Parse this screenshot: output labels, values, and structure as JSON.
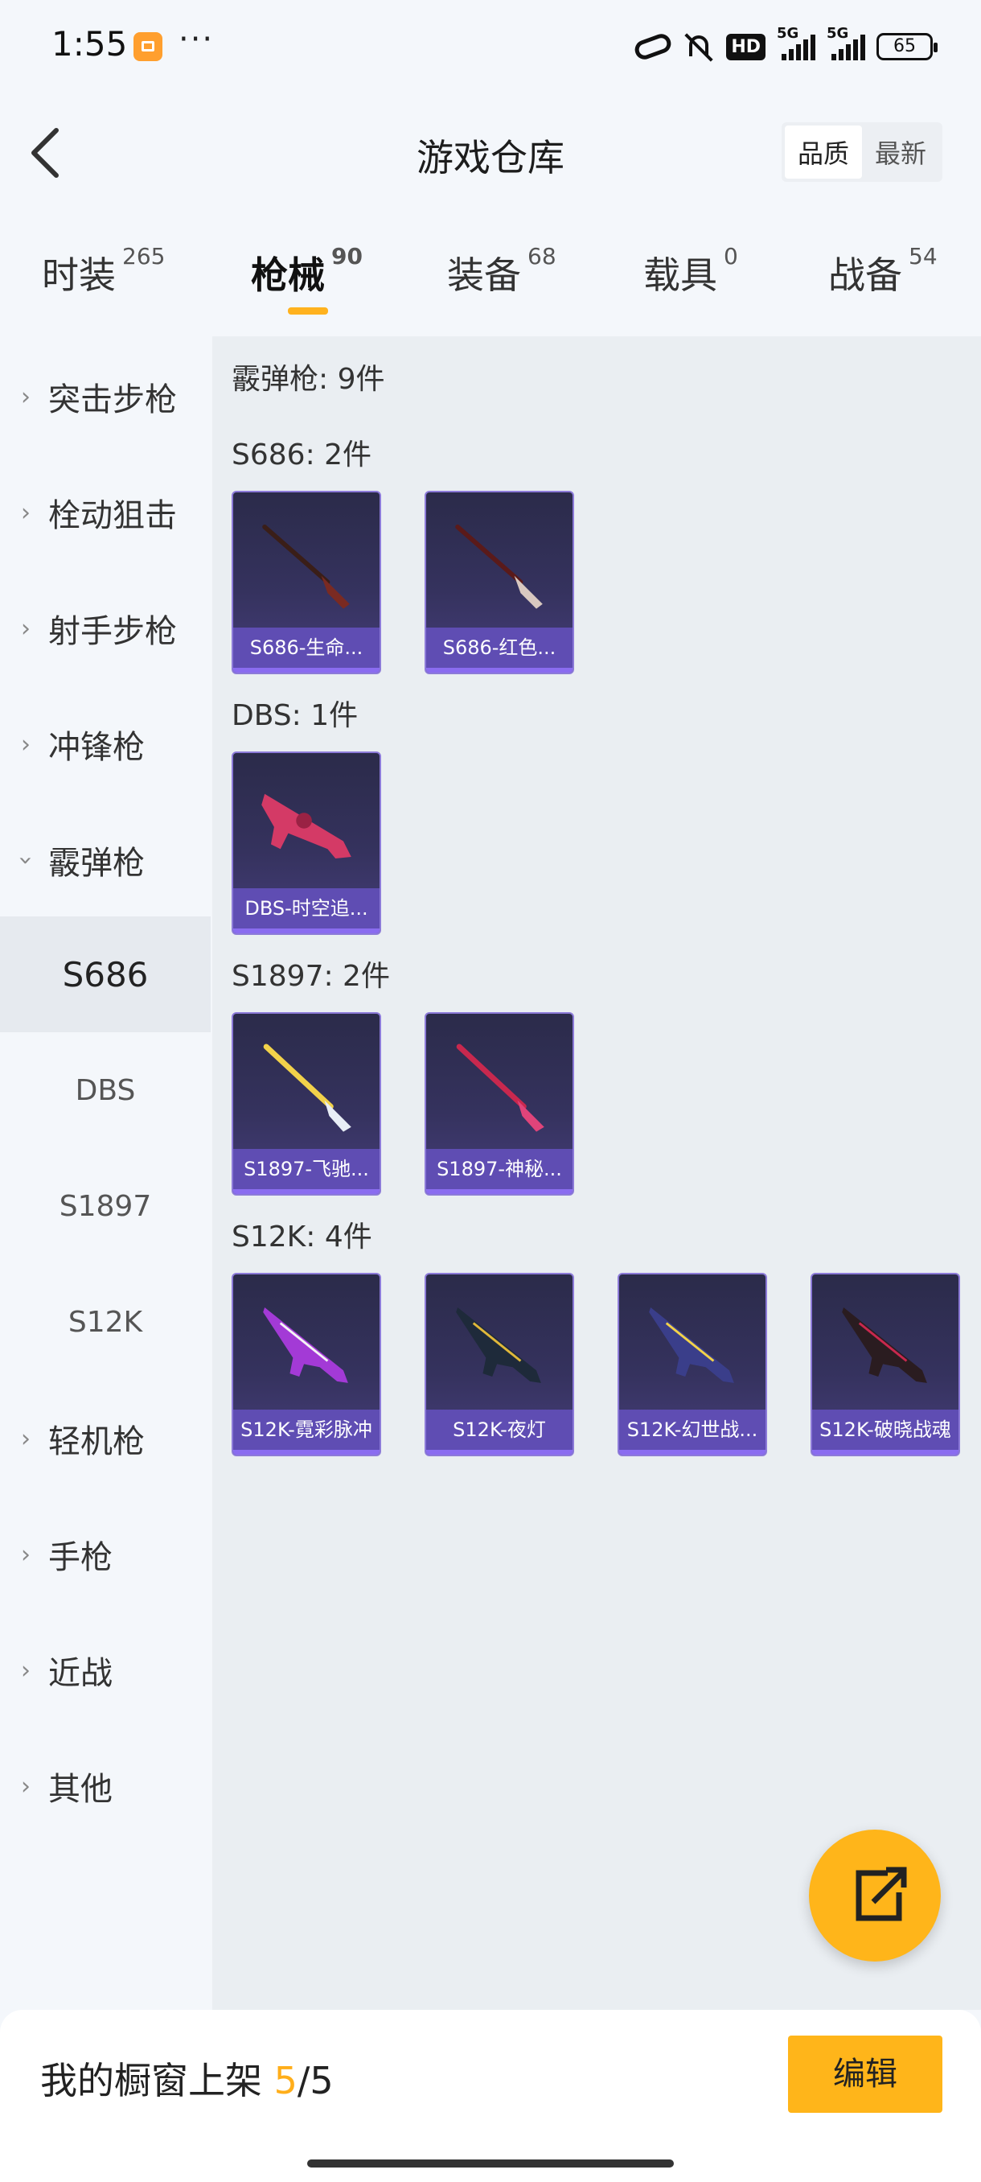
{
  "status": {
    "time": "1:55",
    "dots": "···",
    "hd": "HD",
    "net1": "5G",
    "net2": "5G",
    "battery": "65"
  },
  "header": {
    "title": "游戏仓库",
    "sort": [
      "品质",
      "最新"
    ]
  },
  "tabs": [
    {
      "label": "时装",
      "count": "265"
    },
    {
      "label": "枪械",
      "count": "90"
    },
    {
      "label": "装备",
      "count": "68"
    },
    {
      "label": "载具",
      "count": "0"
    },
    {
      "label": "战备",
      "count": "54"
    }
  ],
  "sidebar": {
    "categories": [
      "突击步枪",
      "栓动狙击",
      "射手步枪",
      "冲锋枪",
      "霰弹枪",
      "轻机枪",
      "手枪",
      "近战",
      "其他"
    ],
    "subs": [
      "S686",
      "DBS",
      "S1897",
      "S12K"
    ]
  },
  "content": {
    "summary": "霰弹枪: 9件",
    "groups": [
      {
        "title": "S686: 2件",
        "items": [
          "S686-生命...",
          "S686-红色..."
        ]
      },
      {
        "title": "DBS: 1件",
        "items": [
          "DBS-时空追..."
        ]
      },
      {
        "title": "S1897: 2件",
        "items": [
          "S1897-飞驰...",
          "S1897-神秘..."
        ]
      },
      {
        "title": "S12K: 4件",
        "items": [
          "S12K-霓彩脉冲",
          "S12K-夜灯",
          "S12K-幻世战...",
          "S12K-破晓战魂"
        ]
      }
    ]
  },
  "footer": {
    "label_prefix": "我的橱窗上架 ",
    "shown": "5",
    "sep": "/",
    "total": "5",
    "edit": "编辑"
  },
  "colors": {
    "accent": "#ffb51a",
    "card_bg": "#35325e",
    "card_label": "#5f4db3"
  }
}
